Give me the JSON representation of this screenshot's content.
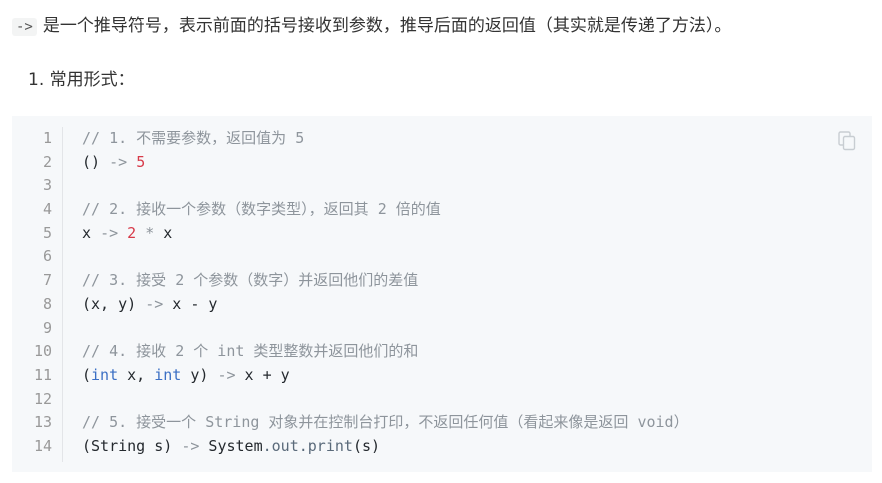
{
  "intro": {
    "code": "->",
    "text": "是一个推导符号，表示前面的括号接收到参数，推导后面的返回值（其实就是传递了方法）。"
  },
  "section_heading": "1. 常用形式：",
  "code": {
    "line_numbers": [
      "1",
      "2",
      "3",
      "4",
      "5",
      "6",
      "7",
      "8",
      "9",
      "10",
      "11",
      "12",
      "13",
      "14"
    ],
    "lines": [
      [
        {
          "t": "// 1. 不需要参数，返回值为 5",
          "c": "c"
        }
      ],
      [
        {
          "t": "() ",
          "c": ""
        },
        {
          "t": "->",
          "c": "op"
        },
        {
          "t": " ",
          "c": ""
        },
        {
          "t": "5",
          "c": "num"
        }
      ],
      [],
      [
        {
          "t": "// 2. 接收一个参数（数字类型），返回其 2 倍的值",
          "c": "c"
        }
      ],
      [
        {
          "t": "x ",
          "c": ""
        },
        {
          "t": "->",
          "c": "op"
        },
        {
          "t": " ",
          "c": ""
        },
        {
          "t": "2",
          "c": "num"
        },
        {
          "t": " * ",
          "c": "op"
        },
        {
          "t": "x",
          "c": ""
        }
      ],
      [],
      [
        {
          "t": "// 3. 接受 2 个参数（数字）并返回他们的差值",
          "c": "c"
        }
      ],
      [
        {
          "t": "(x, y) ",
          "c": ""
        },
        {
          "t": "->",
          "c": "op"
        },
        {
          "t": " x - y",
          "c": ""
        }
      ],
      [],
      [
        {
          "t": "// 4. 接收 2 个 int 类型整数并返回他们的和",
          "c": "c"
        }
      ],
      [
        {
          "t": "(",
          "c": ""
        },
        {
          "t": "int",
          "c": "kw"
        },
        {
          "t": " x, ",
          "c": ""
        },
        {
          "t": "int",
          "c": "kw"
        },
        {
          "t": " y) ",
          "c": ""
        },
        {
          "t": "->",
          "c": "op"
        },
        {
          "t": " x + y",
          "c": ""
        }
      ],
      [],
      [
        {
          "t": "// 5. 接受一个 String 对象并在控制台打印，不返回任何值（看起来像是返回 void）",
          "c": "c"
        }
      ],
      [
        {
          "t": "(String s) ",
          "c": ""
        },
        {
          "t": "->",
          "c": "op"
        },
        {
          "t": " System",
          "c": ""
        },
        {
          "t": ".out.",
          "c": "mem"
        },
        {
          "t": "print",
          "c": "mem"
        },
        {
          "t": "(s)",
          "c": ""
        }
      ]
    ]
  },
  "icons": {
    "copy": "copy-icon"
  }
}
